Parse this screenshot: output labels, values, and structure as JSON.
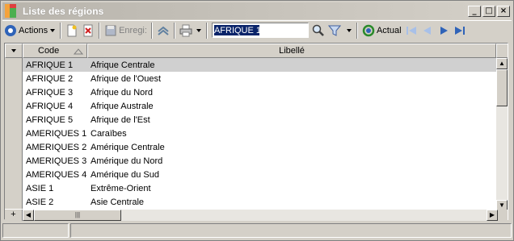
{
  "window": {
    "title": "Liste des régions",
    "controls": [
      "_",
      "□",
      "×"
    ]
  },
  "toolbar": {
    "actions_label": "Actions",
    "save_label": "Enregi:",
    "search_value": "AFRIQUE 1",
    "refresh_label": "Actual",
    "icons": [
      "actions-icon",
      "new-document-icon",
      "delete-icon",
      "save-icon",
      "refresh-icon",
      "print-icon",
      "search-icon",
      "filter-icon",
      "first-icon",
      "previous-icon",
      "next-icon",
      "last-icon"
    ]
  },
  "grid": {
    "columns": {
      "code": "Code",
      "libelle": "Libellé"
    },
    "rows": [
      {
        "code": "AFRIQUE 1",
        "libelle": "Afrique Centrale"
      },
      {
        "code": "AFRIQUE 2",
        "libelle": "Afrique de l'Ouest"
      },
      {
        "code": "AFRIQUE 3",
        "libelle": "Afrique du Nord"
      },
      {
        "code": "AFRIQUE 4",
        "libelle": "Afrique Australe"
      },
      {
        "code": "AFRIQUE 5",
        "libelle": "Afrique de l'Est"
      },
      {
        "code": "AMERIQUES 1",
        "libelle": "Caraïbes"
      },
      {
        "code": "AMERIQUES 2",
        "libelle": "Amérique Centrale"
      },
      {
        "code": "AMERIQUES 3",
        "libelle": "Amérique du Nord"
      },
      {
        "code": "AMERIQUES 4",
        "libelle": "Amérique du Sud"
      },
      {
        "code": "ASIE 1",
        "libelle": "Extrême-Orient"
      },
      {
        "code": "ASIE 2",
        "libelle": "Asie Centrale"
      }
    ],
    "add_row_label": "+"
  }
}
